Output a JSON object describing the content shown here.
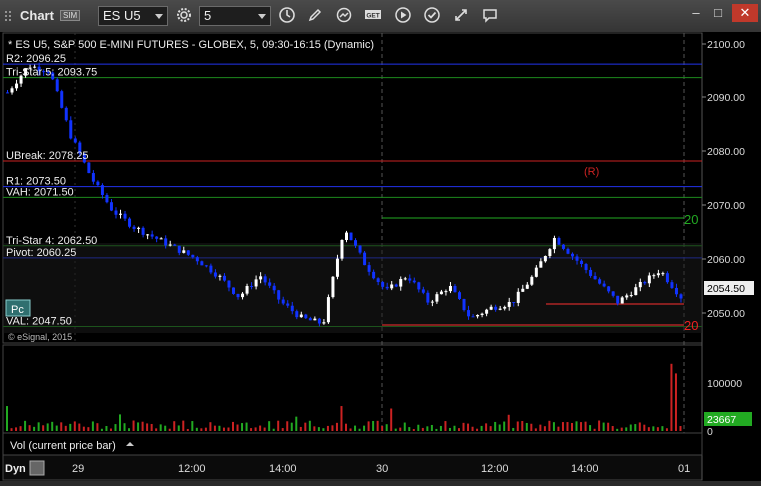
{
  "window": {
    "title": "Chart",
    "sim_badge": "SIM",
    "symbol_value": "ES U5",
    "interval_value": "5",
    "icons": [
      "settings-icon",
      "clock-icon",
      "pencil-icon",
      "refresh-icon",
      "get-icon",
      "play-icon",
      "check-icon",
      "tools-icon",
      "comment-icon",
      "minimize-icon",
      "maximize-icon",
      "close-icon"
    ]
  },
  "chart": {
    "header": "* ES U5, S&P 500 E-MINI FUTURES - GLOBEX, 5, 09:30-16:15 (Dynamic)",
    "copyright": "© eSignal, 2015",
    "pc_badge": "Pc",
    "price_label": "2054.50",
    "r_marker": "(R)",
    "level_labels": [
      {
        "text": "R2: 2096.25",
        "price": 2096.25,
        "color": "#2233ee"
      },
      {
        "text": "Tri-Star 5: 2093.75",
        "price": 2093.75,
        "color": "#1d8a1d"
      },
      {
        "text": "UBreak: 2078.25",
        "price": 2078.25,
        "color": "#cc2222"
      },
      {
        "text": "R1: 2073.50",
        "price": 2073.5,
        "color": "#2233ee"
      },
      {
        "text": "VAH: 2071.50",
        "price": 2071.5,
        "color": "#1d8a1d"
      },
      {
        "text": "Tri-Star 4: 2062.50",
        "price": 2062.5,
        "color": "#1d8a1d"
      },
      {
        "text": "Pivot: 2060.25",
        "price": 2060.25,
        "color": "#2233ee"
      },
      {
        "text": "VAL: 2047.50",
        "price": 2047.5,
        "color": "#1d8a1d"
      }
    ],
    "right_counts": [
      "20",
      "20"
    ],
    "y_ticks": [
      "2100.00",
      "2090.00",
      "2080.00",
      "2070.00",
      "2060.00",
      "2050.00"
    ],
    "vol_ticks": [
      "100000",
      "0"
    ],
    "vol_value": "23667",
    "vol_label": "Vol (current price bar)",
    "x_ticks": [
      "29",
      "12:00",
      "14:00",
      "30",
      "12:00",
      "14:00",
      "01"
    ],
    "dyn_label": "Dyn",
    "colors": {
      "up": "#ffffff",
      "down": "#1133ff",
      "green_line": "#1d8a1d",
      "blue_line": "#2233ee",
      "red_line": "#cc2222",
      "setup": "#22cc22",
      "countdown": "#ff33ff"
    }
  },
  "chart_data": {
    "type": "line",
    "title": "* ES U5, S&P 500 E-MINI FUTURES - GLOBEX, 5, 09:30-16:15 (Dynamic)",
    "xlabel": "",
    "ylabel": "",
    "ylim": [
      2044,
      2103
    ],
    "x": [
      "29",
      "12:00",
      "14:00",
      "30",
      "12:00",
      "14:00",
      "01"
    ],
    "series": [
      {
        "values": [
          2091,
          2096,
          2095,
          2083,
          2075,
          2069,
          2066,
          2064,
          2062,
          2060,
          2057,
          2053,
          2057,
          2052,
          2049,
          2048,
          2066,
          2059,
          2054,
          2057,
          2052,
          2055,
          2049,
          2051,
          2052,
          2057,
          2064,
          2060,
          2056,
          2052,
          2055,
          2058,
          2053
        ]
      }
    ],
    "volume_ylim": [
      0,
      140000
    ],
    "volume_last": 23667
  }
}
